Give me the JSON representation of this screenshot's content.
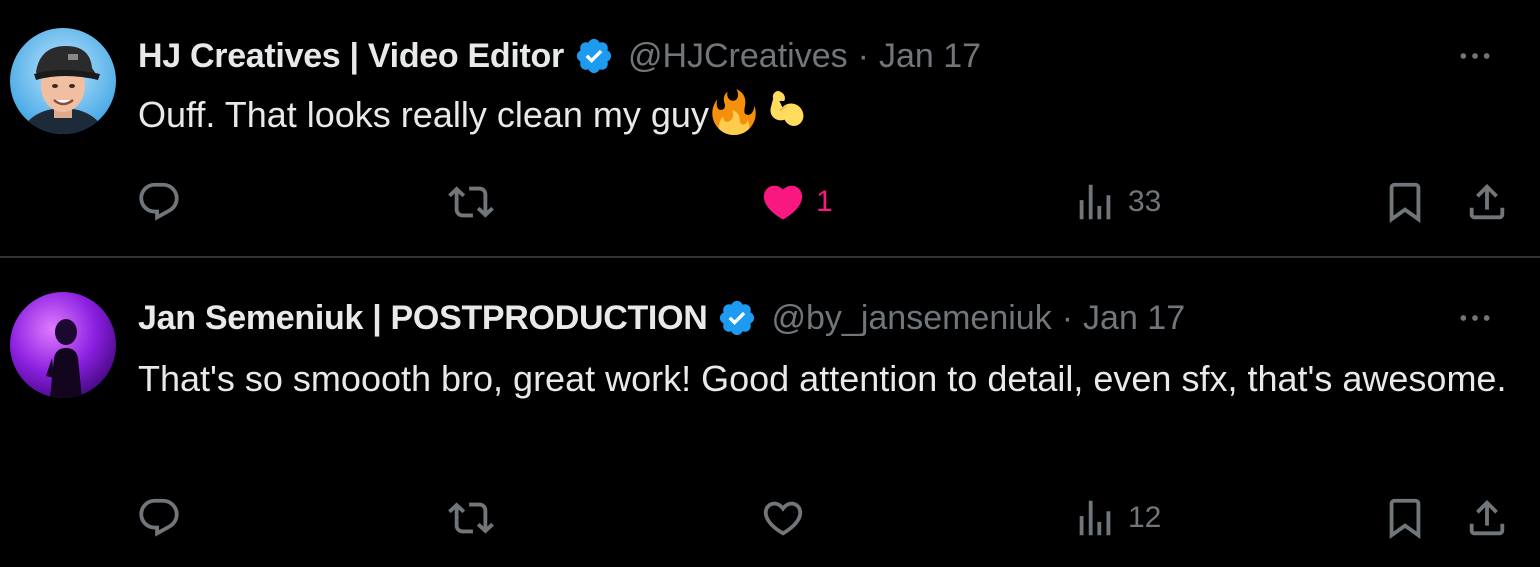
{
  "tweets": [
    {
      "display_name": "HJ Creatives | Video Editor",
      "handle": "@HJCreatives",
      "separator": "·",
      "date": "Jan 17",
      "text": "Ouff. That looks really clean my guy",
      "emojis": [
        "fire-emoji",
        "flexed-biceps-emoji"
      ],
      "verified": true,
      "liked": true,
      "stats": {
        "replies": "",
        "retweets": "",
        "likes": "1",
        "views": "33"
      }
    },
    {
      "display_name": "Jan Semeniuk | POSTPRODUCTION",
      "handle": "@by_jansemeniuk",
      "separator": "·",
      "date": "Jan 17",
      "text": "That's so smoooth bro, great work! Good attention to detail, even sfx, that's awesome.",
      "emojis": [],
      "verified": true,
      "liked": false,
      "stats": {
        "replies": "",
        "retweets": "",
        "likes": "",
        "views": "12"
      }
    }
  ],
  "colors": {
    "background": "#000000",
    "text_primary": "#e7e9ea",
    "text_secondary": "#71767b",
    "verified_blue": "#1d9bf0",
    "like_pink": "#f91880",
    "divider": "#2f3336"
  },
  "icons": {
    "reply": "reply-icon",
    "retweet": "retweet-icon",
    "like": "heart-icon",
    "views": "views-icon",
    "bookmark": "bookmark-icon",
    "share": "share-icon",
    "more": "more-icon",
    "verified": "verified-badge-icon"
  }
}
